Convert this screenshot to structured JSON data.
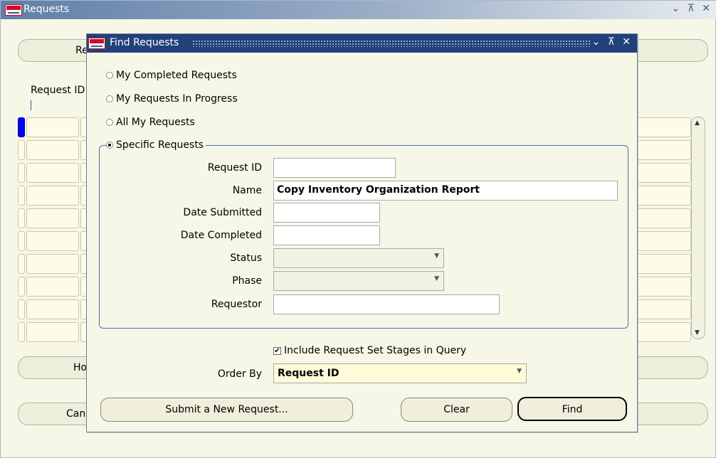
{
  "bg_window": {
    "title": "Requests",
    "controls": "⌄ ⊼ ✕",
    "top_button": "Re",
    "col_request_id": "Request ID",
    "bottom_btn1": "Ho",
    "bottom_btn2": "Can",
    "rows": 10
  },
  "dialog": {
    "title": "Find Requests",
    "controls": "⌄ ⊼ ✕",
    "radios": [
      {
        "label": "My Completed Requests",
        "checked": false
      },
      {
        "label": "My Requests In Progress",
        "checked": false
      },
      {
        "label": "All My Requests",
        "checked": false
      },
      {
        "label": "Specific Requests",
        "checked": true
      }
    ],
    "fields": {
      "request_id": {
        "label": "Request ID",
        "value": ""
      },
      "name": {
        "label": "Name",
        "value": "Copy Inventory Organization Report"
      },
      "date_submitted": {
        "label": "Date Submitted",
        "value": ""
      },
      "date_completed": {
        "label": "Date Completed",
        "value": ""
      },
      "status": {
        "label": "Status",
        "value": ""
      },
      "phase": {
        "label": "Phase",
        "value": ""
      },
      "requestor": {
        "label": "Requestor",
        "value": ""
      }
    },
    "include_stages": {
      "label": "Include Request Set Stages in Query",
      "checked": true
    },
    "order_by": {
      "label": "Order By",
      "value": "Request ID"
    },
    "buttons": {
      "submit": "Submit a New Request...",
      "clear": "Clear",
      "find": "Find"
    }
  }
}
